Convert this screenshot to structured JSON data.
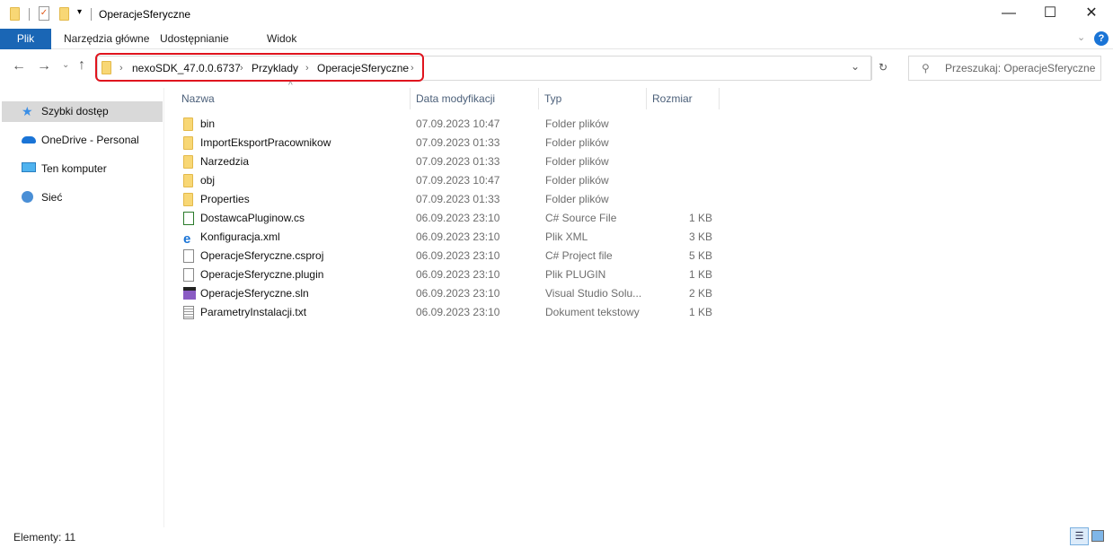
{
  "window": {
    "title": "OperacjeSferyczne"
  },
  "ribbon": {
    "tabs": [
      "Plik",
      "Narzędzia główne",
      "Udostępnianie",
      "Widok"
    ]
  },
  "address": {
    "crumbs": [
      "nexoSDK_47.0.0.6737",
      "Przyklady",
      "OperacjeSferyczne"
    ]
  },
  "search": {
    "placeholder": "Przeszukaj: OperacjeSferyczne"
  },
  "sidebar": {
    "items": [
      {
        "label": "Szybki dostęp",
        "icon": "star-icon"
      },
      {
        "label": "OneDrive - Personal",
        "icon": "cloud-icon"
      },
      {
        "label": "Ten komputer",
        "icon": "computer-icon"
      },
      {
        "label": "Sieć",
        "icon": "network-icon"
      }
    ]
  },
  "columns": {
    "name": "Nazwa",
    "date": "Data modyfikacji",
    "type": "Typ",
    "size": "Rozmiar"
  },
  "files": [
    {
      "name": "bin",
      "date": "07.09.2023 10:47",
      "type": "Folder plików",
      "size": "",
      "icon": "folder"
    },
    {
      "name": "ImportEksportPracownikow",
      "date": "07.09.2023 01:33",
      "type": "Folder plików",
      "size": "",
      "icon": "folder"
    },
    {
      "name": "Narzedzia",
      "date": "07.09.2023 01:33",
      "type": "Folder plików",
      "size": "",
      "icon": "folder"
    },
    {
      "name": "obj",
      "date": "07.09.2023 10:47",
      "type": "Folder plików",
      "size": "",
      "icon": "folder"
    },
    {
      "name": "Properties",
      "date": "07.09.2023 01:33",
      "type": "Folder plików",
      "size": "",
      "icon": "folder"
    },
    {
      "name": "DostawcaPluginow.cs",
      "date": "06.09.2023 23:10",
      "type": "C# Source File",
      "size": "1 KB",
      "icon": "cs"
    },
    {
      "name": "Konfiguracja.xml",
      "date": "06.09.2023 23:10",
      "type": "Plik XML",
      "size": "3 KB",
      "icon": "xml"
    },
    {
      "name": "OperacjeSferyczne.csproj",
      "date": "06.09.2023 23:10",
      "type": "C# Project file",
      "size": "5 KB",
      "icon": "file"
    },
    {
      "name": "OperacjeSferyczne.plugin",
      "date": "06.09.2023 23:10",
      "type": "Plik PLUGIN",
      "size": "1 KB",
      "icon": "file"
    },
    {
      "name": "OperacjeSferyczne.sln",
      "date": "06.09.2023 23:10",
      "type": "Visual Studio Solu...",
      "size": "2 KB",
      "icon": "sln"
    },
    {
      "name": "ParametryInstalacji.txt",
      "date": "06.09.2023 23:10",
      "type": "Dokument tekstowy",
      "size": "1 KB",
      "icon": "txt"
    }
  ],
  "status": {
    "count": "Elementy: 11"
  }
}
